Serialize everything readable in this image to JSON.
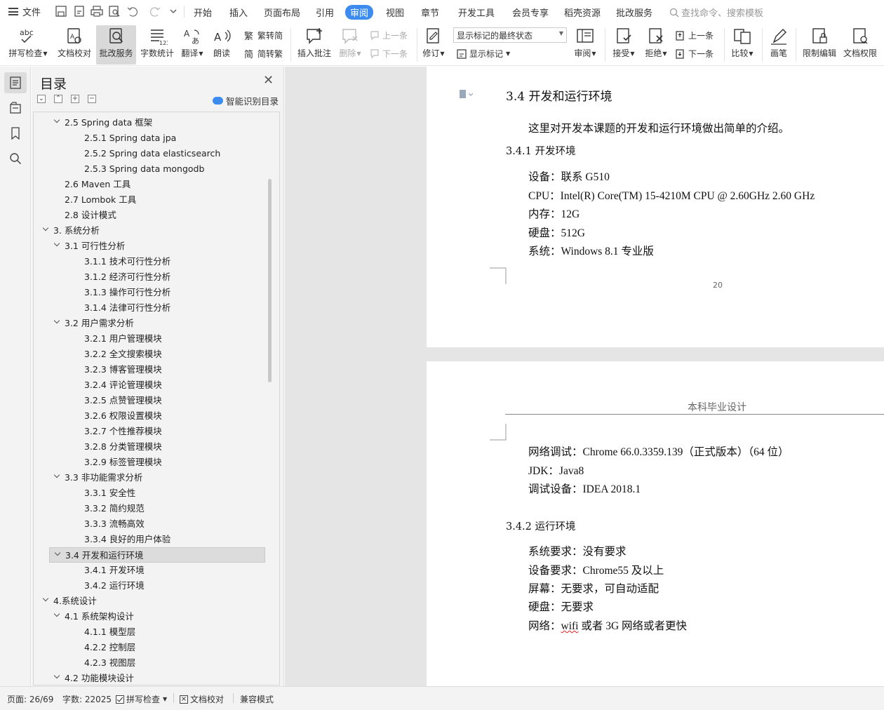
{
  "menubar": {
    "file_label": "文件",
    "tabs": [
      "开始",
      "插入",
      "页面布局",
      "引用",
      "审阅",
      "视图",
      "章节",
      "开发工具",
      "会员专享",
      "稻壳资源",
      "批改服务"
    ],
    "active_tab": "审阅",
    "search_placeholder": "查找命令、搜索模板"
  },
  "ribbon": {
    "spellcheck": "拼写检查",
    "doc_proof": "文档校对",
    "correction_service": "批改服务",
    "word_count": "字数统计",
    "translate": "翻译",
    "read_aloud": "朗读",
    "trad_to_simp": "繁转简",
    "simp_to_trad": "简转繁",
    "insert_comment": "插入批注",
    "delete": "删除",
    "prev_comment": "上一条",
    "next_comment": "下一条",
    "track_changes": "修订",
    "markup_state": "显示标记的最终状态",
    "show_markup": "显示标记",
    "review": "审阅",
    "accept": "接受",
    "reject": "拒绝",
    "prev_change": "上一条",
    "next_change": "下一条",
    "compare": "比较",
    "pen": "画笔",
    "restrict_edit": "限制编辑",
    "doc_permission": "文档权限"
  },
  "toc": {
    "title": "目录",
    "smart_label": "智能识别目录",
    "items": [
      {
        "text": "2.5 Spring data  框架",
        "level": 2,
        "toggle": true
      },
      {
        "text": "2.5.1 Spring data jpa",
        "level": 3,
        "toggle": false
      },
      {
        "text": "2.5.2 Spring data elasticsearch",
        "level": 3,
        "toggle": false
      },
      {
        "text": "2.5.3 Spring data mongodb",
        "level": 3,
        "toggle": false
      },
      {
        "text": "2.6 Maven  工具",
        "level": 2,
        "toggle": false
      },
      {
        "text": "2.7 Lombok  工具",
        "level": 2,
        "toggle": false
      },
      {
        "text": "2.8  设计模式",
        "level": 2,
        "toggle": false
      },
      {
        "text": "3.  系统分析",
        "level": 1,
        "toggle": true
      },
      {
        "text": "3.1  可行性分析",
        "level": 2,
        "toggle": true
      },
      {
        "text": "3.1.1  技术可行性分析",
        "level": 3,
        "toggle": false
      },
      {
        "text": "3.1.2  经济可行性分析",
        "level": 3,
        "toggle": false
      },
      {
        "text": "3.1.3  操作可行性分析",
        "level": 3,
        "toggle": false
      },
      {
        "text": "3.1.4  法律可行性分析",
        "level": 3,
        "toggle": false
      },
      {
        "text": "3.2  用户需求分析",
        "level": 2,
        "toggle": true
      },
      {
        "text": "3.2.1  用户管理模块",
        "level": 3,
        "toggle": false
      },
      {
        "text": "3.2.2  全文搜索模块",
        "level": 3,
        "toggle": false
      },
      {
        "text": "3.2.3  博客管理模块",
        "level": 3,
        "toggle": false
      },
      {
        "text": "3.2.4  评论管理模块",
        "level": 3,
        "toggle": false
      },
      {
        "text": "3.2.5  点赞管理模块",
        "level": 3,
        "toggle": false
      },
      {
        "text": "3.2.6  权限设置模块",
        "level": 3,
        "toggle": false
      },
      {
        "text": "3.2.7  个性推荐模块",
        "level": 3,
        "toggle": false
      },
      {
        "text": "3.2.8 分类管理模块",
        "level": 3,
        "toggle": false
      },
      {
        "text": "3.2.9 标签管理模块",
        "level": 3,
        "toggle": false
      },
      {
        "text": "3.3  非功能需求分析",
        "level": 2,
        "toggle": true
      },
      {
        "text": "3.3.1 安全性",
        "level": 3,
        "toggle": false
      },
      {
        "text": "3.3.2 简约规范",
        "level": 3,
        "toggle": false
      },
      {
        "text": "3.3.3 流畅高效",
        "level": 3,
        "toggle": false
      },
      {
        "text": "3.3.4 良好的用户体验",
        "level": 3,
        "toggle": false
      },
      {
        "text": "3.4  开发和运行环境",
        "level": 2,
        "toggle": true,
        "selected": true
      },
      {
        "text": "3.4.1  开发环境",
        "level": 3,
        "toggle": false
      },
      {
        "text": "3.4.2  运行环境",
        "level": 3,
        "toggle": false
      },
      {
        "text": "4.系统设计",
        "level": 1,
        "toggle": true
      },
      {
        "text": "4.1  系统架构设计",
        "level": 2,
        "toggle": true
      },
      {
        "text": "4.1.1 模型层",
        "level": 3,
        "toggle": false
      },
      {
        "text": "4.2.2 控制层",
        "level": 3,
        "toggle": false
      },
      {
        "text": "4.2.3 视图层",
        "level": 3,
        "toggle": false
      },
      {
        "text": "4.2  功能模块设计",
        "level": 2,
        "toggle": true
      }
    ]
  },
  "document": {
    "page1": {
      "heading": "3.4  开发和运行环境",
      "intro": "这里对开发本课题的开发和运行环境做出简单的介绍。",
      "sub_heading": "3.4.1  开发环境",
      "lines": [
        "设备：联系 G510",
        "CPU：Intel(R) Core(TM) 15-4210M CPU @ 2.60GHz 2.60 GHz",
        "内存：12G",
        "硬盘：512G",
        "系统：Windows 8.1 专业版"
      ],
      "page_number": "20"
    },
    "page2": {
      "header": "本科毕业设计",
      "lines_a": [
        "网络调试：Chrome 66.0.3359.139（正式版本）（64  位）",
        "JDK：Java8",
        "调试设备：IDEA 2018.1"
      ],
      "sub_heading": "3.4.2  运行环境",
      "lines_b": [
        "系统要求：没有要求",
        "设备要求：Chrome55 及以上",
        "屏幕：无要求，可自动适配",
        "硬盘：无要求"
      ],
      "net_prefix": "网络：",
      "net_wifi": "wifi",
      "net_rest": " 或者 3G 网络或者更快"
    }
  },
  "statusbar": {
    "page": "页面: 26/69",
    "word_count": "字数: 22025",
    "spellcheck": "拼写检查",
    "doc_proof": "文档校对",
    "compat_mode": "兼容模式"
  },
  "colors": {
    "accent": "#3c8cf0",
    "panel_bg": "#f3f3f3",
    "doc_bg": "#e5e5e5"
  }
}
